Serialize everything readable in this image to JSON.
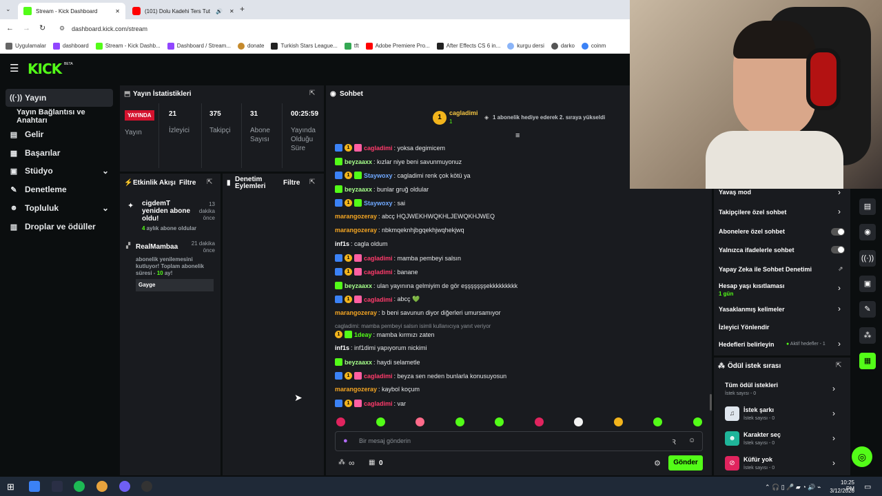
{
  "browser": {
    "tabs": [
      {
        "label": "Stream - Kick Dashboard",
        "close": "✕"
      },
      {
        "label": "(101) Dolu Kadehi Ters Tut",
        "close": "✕"
      }
    ],
    "new_tab": "+",
    "url": "dashboard.kick.com/stream",
    "bookmarks": [
      "Uygulamalar",
      "dashboard",
      "Stream - Kick Dashb...",
      "Dashboard / Stream...",
      "donate",
      "Turkish Stars League...",
      "tft",
      "Adobe Premiere Pro...",
      "After Effects CS 6 in...",
      "kurgu dersi",
      "darko",
      "coinm"
    ]
  },
  "header": {
    "logo": "KICK",
    "beta": "BETA"
  },
  "sidebar": {
    "items": [
      {
        "label": "Yayın",
        "icon": "stream-icon"
      },
      {
        "label": "Yayın Bağlantısı ve Anahtarı",
        "icon": ""
      },
      {
        "label": "Gelir",
        "icon": "money-icon"
      },
      {
        "label": "Başarılar",
        "icon": "trophy-icon"
      },
      {
        "label": "Stüdyo",
        "icon": "studio-icon"
      },
      {
        "label": "Denetleme",
        "icon": "wrench-icon"
      },
      {
        "label": "Topluluk",
        "icon": "community-icon"
      },
      {
        "label": "Droplar ve ödüller",
        "icon": "drops-icon"
      }
    ]
  },
  "stats": {
    "title": "Yayın İstatistikleri",
    "live_badge": "YAYINDA",
    "live_label": "Yayın",
    "items": [
      {
        "value": "21",
        "label": "İzleyici"
      },
      {
        "value": "375",
        "label": "Takipçi"
      },
      {
        "value": "31",
        "label": "Abone Sayısı"
      },
      {
        "value": "00:25:59",
        "label": "Yayında Olduğu Süre"
      }
    ]
  },
  "activity": {
    "title": "Etkinlik Akışı",
    "filter": "Filtre",
    "events": [
      {
        "user": "cigdemT yeniden abone oldu!",
        "time": "13 dakika önce",
        "detail_num": "4",
        "detail": " aylık abone oldular"
      },
      {
        "user": "RealMambaa",
        "time": "21 dakika önce",
        "text": "abonelik yenilemesini kutluyor! Toplam abonelik süresi - ",
        "num": "10",
        "suffix": " ay!",
        "note": "Gayge"
      }
    ]
  },
  "moderation": {
    "title": "Denetim Eylemleri",
    "filter": "Filtre"
  },
  "chat": {
    "title": "Sohbet",
    "pinned_user": "cagladimi",
    "pinned_rank": "1",
    "pinned_info": "1 abonelik hediye ederek 2. sıraya yükseldi",
    "messages": [
      {
        "user": "cagladimi",
        "color": "#ff3b6b",
        "badges": [
          "bl",
          "gd",
          "pk"
        ],
        "text": ": yoksa degimicem"
      },
      {
        "user": "beyzaaxx",
        "color": "#a6ff8a",
        "badges": [
          "gr"
        ],
        "text": ": kızlar niye beni savunmuyonuz"
      },
      {
        "user": "Staywoxy",
        "color": "#6fa8ff",
        "badges": [
          "bl",
          "gd",
          "gr"
        ],
        "text": ": cagladimi renk çok kötü ya"
      },
      {
        "user": "beyzaaxx",
        "color": "#a6ff8a",
        "badges": [
          "gr"
        ],
        "text": ": bunlar gruğ oldular"
      },
      {
        "user": "Staywoxy",
        "color": "#6fa8ff",
        "badges": [
          "bl",
          "gd",
          "gr"
        ],
        "text": ": sai"
      },
      {
        "user": "marangozeray",
        "color": "#f5a623",
        "badges": [],
        "text": ": abcç HQJWEKHWQKHLJEWQKHJWEQ"
      },
      {
        "user": "marangozeray",
        "color": "#f5a623",
        "badges": [],
        "text": ": nbkmqeknhjbgqekhjwqhekjwq"
      },
      {
        "user": "inf1s",
        "color": "#ffffff",
        "badges": [],
        "text": ": cagla oldum"
      },
      {
        "user": "cagladimi",
        "color": "#ff3b6b",
        "badges": [
          "bl",
          "gd",
          "pk"
        ],
        "text": ": mamba pembeyi salsın"
      },
      {
        "user": "cagladimi",
        "color": "#ff3b6b",
        "badges": [
          "bl",
          "gd",
          "pk"
        ],
        "text": ": banane"
      },
      {
        "user": "beyzaaxx",
        "color": "#a6ff8a",
        "badges": [
          "gr"
        ],
        "text": ": ulan yayınına gelmiyim de gör eşşşşşşşekkkkkkkkk"
      },
      {
        "user": "cagladimi",
        "color": "#ff3b6b",
        "badges": [
          "bl",
          "gd",
          "pk"
        ],
        "text": ": abcç 💚"
      },
      {
        "user": "marangozeray",
        "color": "#f5a623",
        "badges": [],
        "text": ": b beni savunun diyor diğerleri umursamıyor"
      },
      {
        "user": "1deay",
        "color": "#53fc18",
        "badges": [
          "gd",
          "gr"
        ],
        "text": ": mamba kırmızı zaten"
      },
      {
        "user": "inf1s",
        "color": "#ffffff",
        "badges": [],
        "text": ": inf1dimi yapıyorum nickimi"
      },
      {
        "user": "beyzaaxx",
        "color": "#a6ff8a",
        "badges": [
          "gr"
        ],
        "text": ": haydi selametle"
      },
      {
        "user": "cagladimi",
        "color": "#ff3b6b",
        "badges": [
          "bl",
          "gd",
          "pk"
        ],
        "text": ": beyza sen neden bunlarla konusuyosun"
      },
      {
        "user": "marangozeray",
        "color": "#f5a623",
        "badges": [],
        "text": ": kaybol koçum"
      },
      {
        "user": "cagladimi",
        "color": "#ff3b6b",
        "badges": [
          "bl",
          "gd",
          "pk"
        ],
        "text": ": var"
      }
    ],
    "reply_hint": "cagladimi: mamba pembeyi salsın isimli kullanıcıya yanıt veriyor",
    "input_placeholder": "Bir mesaj gönderin",
    "points": "∞",
    "gift_count": "0",
    "send": "Gönder"
  },
  "mod_panel": {
    "rows": [
      {
        "label": "Yavaş mod"
      },
      {
        "label": "Takipçilere özel sohbet"
      },
      {
        "label": "Abonelere özel sohbet"
      },
      {
        "label": "Yalnızca ifadelerle sohbet"
      },
      {
        "label": "Yapay Zeka ile Sohbet Denetimi"
      },
      {
        "label": "Hesap yaşı kısıtlaması",
        "sub": "1 gün"
      },
      {
        "label": "Yasaklanmış kelimeler"
      },
      {
        "label": "İzleyici Yönlendir"
      },
      {
        "label": "Hedefleri belirleyin",
        "extra": "Aktif hedefler - 1"
      }
    ]
  },
  "rewards": {
    "title": "Ödül istek sırası",
    "items": [
      {
        "title": "Tüm ödül istekleri",
        "sub": "İstek sayısı - 0"
      },
      {
        "title": "İstek şarkı",
        "sub": "İstek sayısı - 0"
      },
      {
        "title": "Karakter seç",
        "sub": "İstek sayısı - 0"
      },
      {
        "title": "Küfür yok",
        "sub": "İstek sayısı - 0"
      }
    ]
  },
  "taskbar": {
    "time": "10:25 PM",
    "date": "3/12/2026"
  }
}
